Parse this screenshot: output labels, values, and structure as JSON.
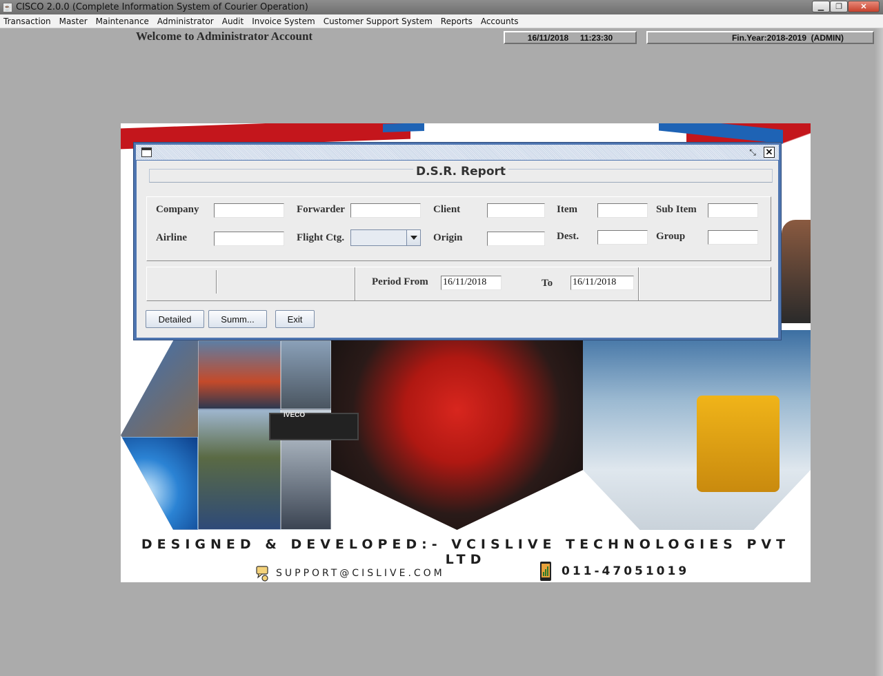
{
  "window": {
    "title": "CISCO 2.0.0 (Complete Information System of Courier Operation)",
    "app_icon": "java-cup-icon"
  },
  "menu": [
    "Transaction",
    "Master",
    "Maintenance",
    "Administrator",
    "Audit",
    "Invoice System",
    "Customer Support System",
    "Reports",
    "Accounts"
  ],
  "header": {
    "welcome": "Welcome to Administrator Account",
    "datetime": "16/11/2018     11:23:30",
    "finyear": "Fin.Year:2018-2019  (ADMIN)"
  },
  "banner": {
    "developer": "DESIGNED & DEVELOPED:- VCISLIVE TECHNOLOGIES PVT LTD",
    "email": "SUPPORT@CISLIVE.COM",
    "phone": "011-47051019",
    "truck_brand": "IVECO"
  },
  "report": {
    "title": "D.S.R. Report",
    "labels": {
      "company": "Company",
      "forwarder": "Forwarder",
      "client": "Client",
      "item": "Item",
      "sub_item": "Sub Item",
      "airline": "Airline",
      "flight_ctg": "Flight Ctg.",
      "origin": "Origin",
      "dest": "Dest.",
      "group": "Group",
      "period_from": "Period From",
      "to": "To"
    },
    "values": {
      "company": "",
      "forwarder": "",
      "client": "",
      "item": "",
      "sub_item": "",
      "airline": "",
      "flight_ctg": "",
      "origin": "",
      "dest": "",
      "group": "",
      "period_from": "16/11/2018",
      "period_to": "16/11/2018"
    },
    "buttons": {
      "detailed": "Detailed",
      "summary": "Summ...",
      "exit": "Exit"
    }
  },
  "colors": {
    "desktop": "#ababab",
    "frame_border": "#4e75b0",
    "panel_bg": "#ececec",
    "brand_red": "#c4161c",
    "brand_blue": "#1e63b5"
  }
}
